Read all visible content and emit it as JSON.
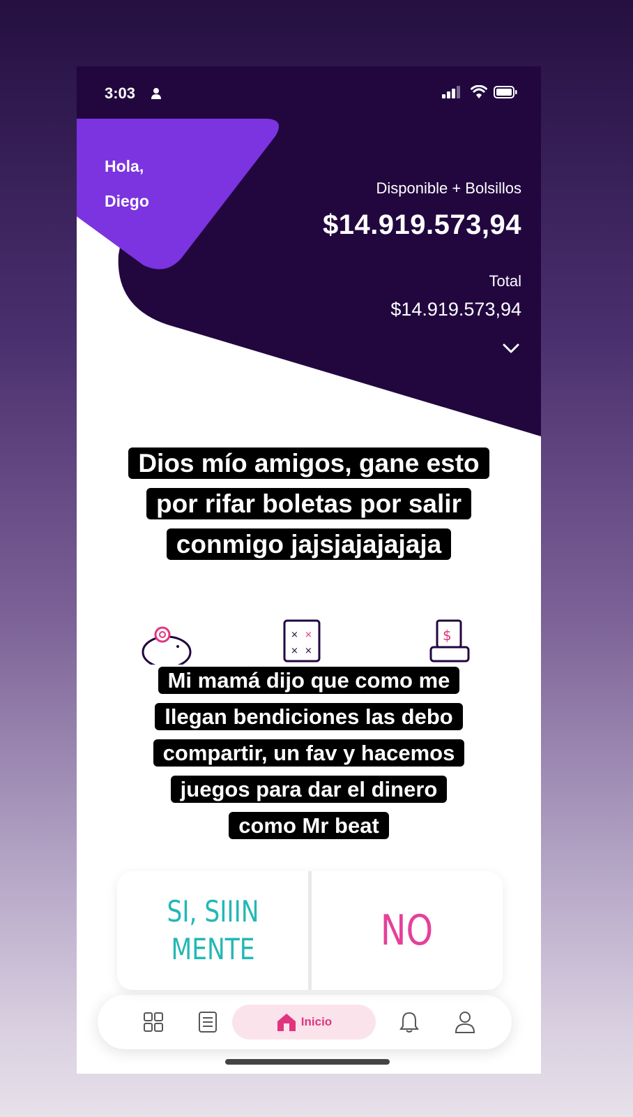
{
  "status_bar": {
    "time": "3:03",
    "icons": [
      "person-icon",
      "signal-icon",
      "wifi-icon",
      "battery-icon"
    ]
  },
  "greeting": {
    "line1": "Hola,",
    "line2": "Diego"
  },
  "balance": {
    "label": "Disponible + Bolsillos",
    "amount": "$14.919.573,94",
    "total_label": "Total",
    "total_amount": "$14.919.573,94"
  },
  "captions": {
    "top_lines": [
      "Dios mío amigos, gane esto",
      "por rifar boletas por salir",
      "conmigo jajsjajajajaja"
    ],
    "bottom_lines": [
      "Mi mamá dijo que como me",
      "llegan bendiciones las debo",
      "compartir, un fav y hacemos",
      "juegos para dar el dinero",
      "como Mr beat"
    ]
  },
  "quick_actions": [
    "piggy-bank-icon",
    "card-icon",
    "atm-icon"
  ],
  "poll": {
    "yes_line1": "SI, SIIIN",
    "yes_line2": "MENTE",
    "no_label": "NO"
  },
  "tab_bar": {
    "items": [
      "apps-grid-icon",
      "document-icon",
      "home-icon",
      "bell-icon",
      "profile-icon"
    ],
    "home_label": "Inicio",
    "home_color": "#e0357e"
  },
  "colors": {
    "hero_dark": "#22073f",
    "hero_accent": "#7b34e0",
    "poll_yes": "#22b8b5",
    "poll_no": "#e5409a"
  }
}
